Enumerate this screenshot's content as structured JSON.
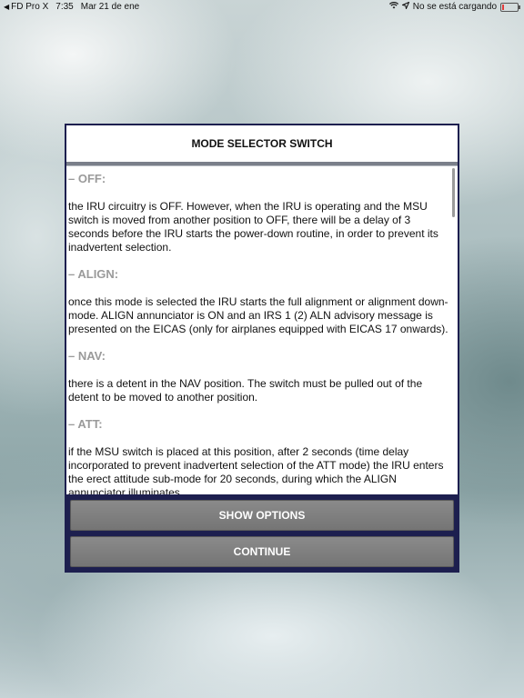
{
  "status_bar": {
    "back_app": "FD Pro X",
    "time": "7:35",
    "date": "Mar 21 de ene",
    "charging_status": "No se está cargando"
  },
  "dialog": {
    "title": "MODE SELECTOR SWITCH",
    "sections": [
      {
        "title": "– OFF:",
        "text": "the IRU circuitry is OFF. However, when the IRU is operating and the MSU switch is moved from another position to OFF, there will be a delay of 3 seconds before the IRU starts the power-down routine, in order to prevent its inadvertent selection."
      },
      {
        "title": "– ALIGN:",
        "text": "once this mode is selected the IRU starts the full alignment or alignment down-mode. ALIGN annunciator is ON and an IRS 1 (2) ALN advisory message is presented on the EICAS (only for airplanes equipped with EICAS 17 onwards)."
      },
      {
        "title": "– NAV:",
        "text": "there is a detent in the NAV position. The switch must be pulled out of the detent to be moved to another position."
      },
      {
        "title": "– ATT:",
        "text": "if the MSU switch is placed at this position, after 2 seconds (time delay incorporated to prevent inadvertent selection of the ATT mode) the IRU enters the erect attitude sub-mode for 20 seconds, during which the ALIGN annunciator illuminates."
      }
    ],
    "show_options_label": "SHOW OPTIONS",
    "continue_label": "CONTINUE"
  }
}
